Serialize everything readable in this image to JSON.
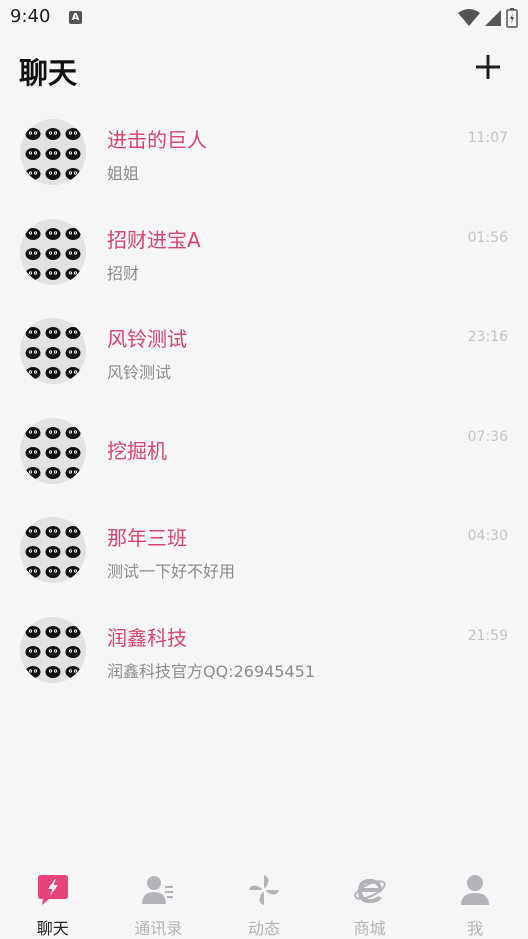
{
  "status": {
    "time": "9:40",
    "badge": "A"
  },
  "header": {
    "title": "聊天"
  },
  "chats": [
    {
      "name": "进击的巨人",
      "preview": "姐姐",
      "time": "11:07"
    },
    {
      "name": "招财进宝A",
      "preview": "招财",
      "time": "01:56"
    },
    {
      "name": "风铃测试",
      "preview": "风铃测试",
      "time": "23:16"
    },
    {
      "name": "挖掘机",
      "preview": "",
      "time": "07:36"
    },
    {
      "name": "那年三班",
      "preview": "测试一下好不好用",
      "time": "04:30"
    },
    {
      "name": "润鑫科技",
      "preview": "润鑫科技官方QQ:26945451",
      "time": "21:59"
    }
  ],
  "tabs": [
    {
      "label": "聊天",
      "icon": "chat-bubble-icon",
      "active": true
    },
    {
      "label": "通讯录",
      "icon": "contacts-icon",
      "active": false
    },
    {
      "label": "动态",
      "icon": "pinwheel-icon",
      "active": false
    },
    {
      "label": "商城",
      "icon": "browser-e-icon",
      "active": false
    },
    {
      "label": "我",
      "icon": "person-icon",
      "active": false
    }
  ],
  "colors": {
    "accent": "#d8456a",
    "active_tab_icon": "#e8427a",
    "inactive": "#b4b4b8"
  }
}
